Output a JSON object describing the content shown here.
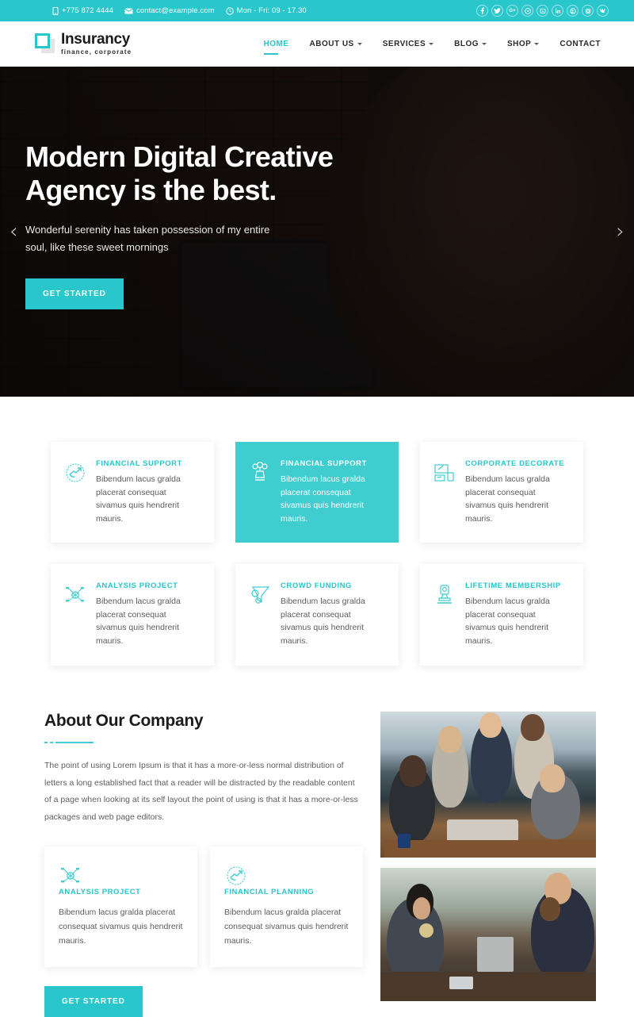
{
  "topbar": {
    "phone": "+775 872 4444",
    "email": "contact@example.com",
    "hours": "Mon - Fri: 09 - 17.30",
    "phone_icon": "phone-icon",
    "email_icon": "envelope-icon",
    "hours_icon": "clock-icon",
    "bg_color": "#29c6cb",
    "socials": [
      {
        "name": "facebook",
        "glyph": "f"
      },
      {
        "name": "twitter",
        "glyph": "t"
      },
      {
        "name": "google-plus",
        "glyph": "G+"
      },
      {
        "name": "dribbble",
        "glyph": "d"
      },
      {
        "name": "youtube",
        "glyph": "yt"
      },
      {
        "name": "linkedin",
        "glyph": "in"
      },
      {
        "name": "behance",
        "glyph": "Be"
      },
      {
        "name": "instagram",
        "glyph": "ig"
      },
      {
        "name": "vk",
        "glyph": "vk"
      }
    ]
  },
  "header": {
    "logo_name": "Insurancy",
    "logo_tagline": "finance, corporate",
    "nav": [
      {
        "label": "HOME",
        "active": true,
        "caret": false
      },
      {
        "label": "ABOUT US",
        "active": false,
        "caret": true
      },
      {
        "label": "SERVICES",
        "active": false,
        "caret": true
      },
      {
        "label": "BLOG",
        "active": false,
        "caret": true
      },
      {
        "label": "SHOP",
        "active": false,
        "caret": true
      },
      {
        "label": "CONTACT",
        "active": false,
        "caret": false
      }
    ]
  },
  "hero": {
    "title": "Modern Digital Creative Agency is the best.",
    "subtitle": "Wonderful serenity has taken possession of my entire soul, like these sweet mornings",
    "cta": "GET STARTED",
    "prev_arrow": "‹",
    "next_arrow": "›",
    "accent_color": "#29c6cb"
  },
  "services": {
    "cards": [
      {
        "title": "FINANCIAL SUPPORT",
        "desc": "Bibendum lacus gralda placerat consequat sivamus quis hendrerit mauris.",
        "icon": "handshake-icon",
        "featured": false
      },
      {
        "title": "FINANCIAL SUPPORT",
        "desc": "Bibendum lacus gralda placerat consequat sivamus quis hendrerit mauris.",
        "icon": "podium-idea-icon",
        "featured": true
      },
      {
        "title": "CORPORATE DECORATE",
        "desc": "Bibendum lacus gralda placerat consequat sivamus quis hendrerit mauris.",
        "icon": "devices-design-icon",
        "featured": false
      },
      {
        "title": "ANALYSIS PROJECT",
        "desc": "Bibendum lacus gralda placerat consequat sivamus quis hendrerit mauris.",
        "icon": "network-analysis-icon",
        "featured": false
      },
      {
        "title": "CROWD FUNDING",
        "desc": "Bibendum lacus gralda placerat consequat sivamus quis hendrerit mauris.",
        "icon": "funnel-coin-icon",
        "featured": false
      },
      {
        "title": "LIFETIME MEMBERSHIP",
        "desc": "Bibendum lacus gralda placerat consequat sivamus quis hendrerit mauris.",
        "icon": "badge-stamp-icon",
        "featured": false
      }
    ]
  },
  "about": {
    "heading": "About Our Company",
    "paragraph": "The point of using Lorem Ipsum is that it has a more-or-less normal distribution of letters a long established fact that a reader will be distracted by the readable content of a page when looking at its self layout the point of using is that it has a more-or-less packages and web page editors.",
    "cards": [
      {
        "title": "ANALYSIS PROJECT",
        "desc": "Bibendum lacus gralda placerat consequat sivamus quis hendrerit mauris.",
        "icon": "network-analysis-icon"
      },
      {
        "title": "FINANCIAL PLANNING",
        "desc": "Bibendum lacus gralda placerat consequat sivamus quis hendrerit mauris.",
        "icon": "handshake-icon"
      }
    ],
    "cta": "GET STARTED",
    "photos": [
      {
        "name": "business-team-meeting-photo"
      },
      {
        "name": "two-people-outdoor-meeting-photo"
      }
    ]
  }
}
